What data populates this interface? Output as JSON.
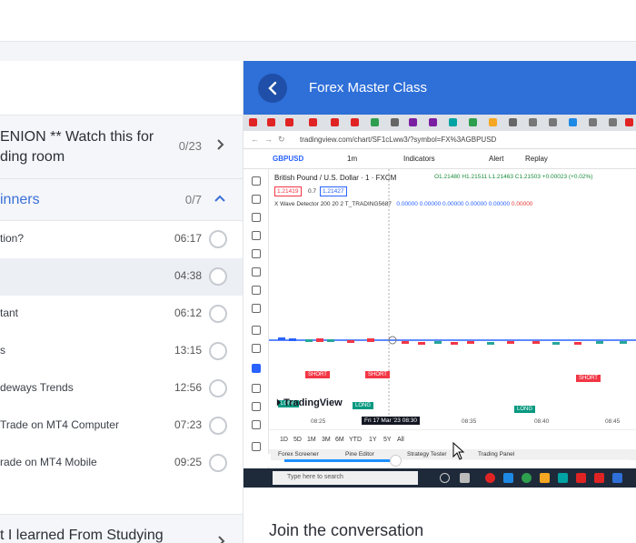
{
  "sidebar": {
    "section1": {
      "title": "ENION ** Watch this for ding room",
      "title_line1": "ENION ** Watch this for",
      "title_line2": "ding room",
      "count": "0/23"
    },
    "section2": {
      "title": "inners",
      "count": "0/7"
    },
    "lessons": [
      {
        "title": "tion?",
        "duration": "06:17",
        "active": false
      },
      {
        "title": "",
        "duration": "04:38",
        "active": true
      },
      {
        "title": "tant",
        "duration": "06:12",
        "active": false
      },
      {
        "title": "s",
        "duration": "13:15",
        "active": false
      },
      {
        "title": "deways Trends",
        "duration": "12:56",
        "active": false
      },
      {
        "title": "Trade on MT4 Computer",
        "duration": "07:23",
        "active": false
      },
      {
        "title": "rade on MT4 Mobile",
        "duration": "09:25",
        "active": false
      }
    ],
    "section3": {
      "title": "t I learned From Studying"
    }
  },
  "player": {
    "header_title": "Forex Master Class",
    "progress": 0.32,
    "screen": {
      "url": "tradingview.com/chart/SF1cLww3/?symbol=FX%3AGBPUSD",
      "symbol": "GBPUSD",
      "interval": "1m",
      "indicators_label": "Indicators",
      "alert_label": "Alert",
      "replay_label": "Replay",
      "chart_title": "British Pound / U.S. Dollar · 1 · FXCM",
      "ohlc": "O1.21480 H1.21511 L1.21463 C1.21503 +0.00023 (+0.02%)",
      "sell_price": "1.21419",
      "spread": "0.7",
      "buy_price": "1.21427",
      "indicator_name": "X Wave Detector 200 20 2 T_TRADING5687",
      "indicator_values": "0.00000 0.00000 0.00000 0.00000 0.00000",
      "indicator_value_red": "0.00000",
      "labels": {
        "short": "SHORT",
        "long": "LONG"
      },
      "watermark": "TradingView",
      "time_ticks": [
        "08:25",
        "08:35",
        "08:40",
        "08:45"
      ],
      "current_time": "Fri 17 Mar '23   08:30",
      "ranges": [
        "1D",
        "5D",
        "1M",
        "3M",
        "6M",
        "YTD",
        "1Y",
        "5Y",
        "All"
      ],
      "panels": [
        "Forex Screener",
        "Pine Editor",
        "Strategy Tester",
        "Trading Panel"
      ],
      "taskbar_search": "Type here to search"
    }
  },
  "conversation": {
    "title": "Join the conversation"
  },
  "colors": {
    "accent": "#2e6fd8",
    "short": "#f23645",
    "long": "#089981",
    "progress": "#1e90ff"
  }
}
